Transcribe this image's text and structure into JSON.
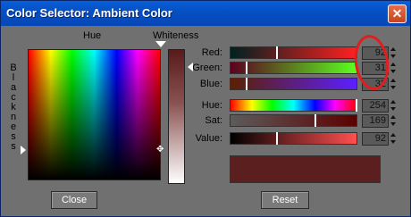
{
  "window": {
    "title": "Color Selector: Ambient Color",
    "close_glyph": "✕"
  },
  "picker": {
    "hue_label": "Hue",
    "whiteness_label": "Whiteness",
    "blackness_letters": [
      "B",
      "l",
      "a",
      "c",
      "k",
      "n",
      "e",
      "s",
      "s"
    ]
  },
  "channels": [
    {
      "label": "Red:",
      "value": "92",
      "key": "red"
    },
    {
      "label": "Green:",
      "value": "31",
      "key": "green"
    },
    {
      "label": "Blue:",
      "value": "32",
      "key": "blue"
    },
    {
      "label": "Hue:",
      "value": "254",
      "key": "hue"
    },
    {
      "label": "Sat:",
      "value": "169",
      "key": "sat"
    },
    {
      "label": "Value:",
      "value": "92",
      "key": "value"
    }
  ],
  "swatch_color": "#5c1f20",
  "buttons": {
    "close": "Close",
    "reset": "Reset"
  },
  "annotation_color": "#e21d1d"
}
